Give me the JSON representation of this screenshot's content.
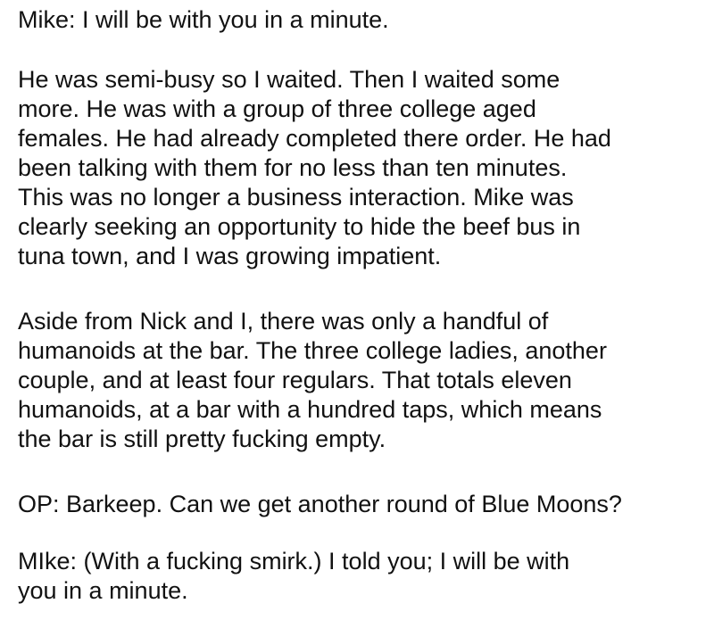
{
  "paragraphs": [
    {
      "lines": [
        "Mike: I will be with you in a minute."
      ]
    },
    {
      "lines": [
        "He was semi-busy so I waited. Then I waited some",
        "more. He was with a group of three college aged",
        "females. He had already completed there order. He had",
        "been talking with them for no less than ten minutes.",
        "This was no longer a business interaction. Mike was",
        "clearly seeking an opportunity to hide the beef bus in",
        "tuna town, and I was growing impatient."
      ]
    },
    {
      "lines": [
        "Aside from Nick and I, there was only a handful of",
        "humanoids at the bar. The three college ladies, another",
        "couple, and at least four regulars. That totals eleven",
        "humanoids, at a bar with a hundred taps, which means",
        "the bar is still pretty fucking empty."
      ]
    },
    {
      "lines": [
        "OP: Barkeep. Can we get another round of Blue Moons?"
      ]
    },
    {
      "lines": [
        "MIke: (With a fucking smirk.) I told you; I will be with",
        "you in a minute."
      ]
    }
  ]
}
